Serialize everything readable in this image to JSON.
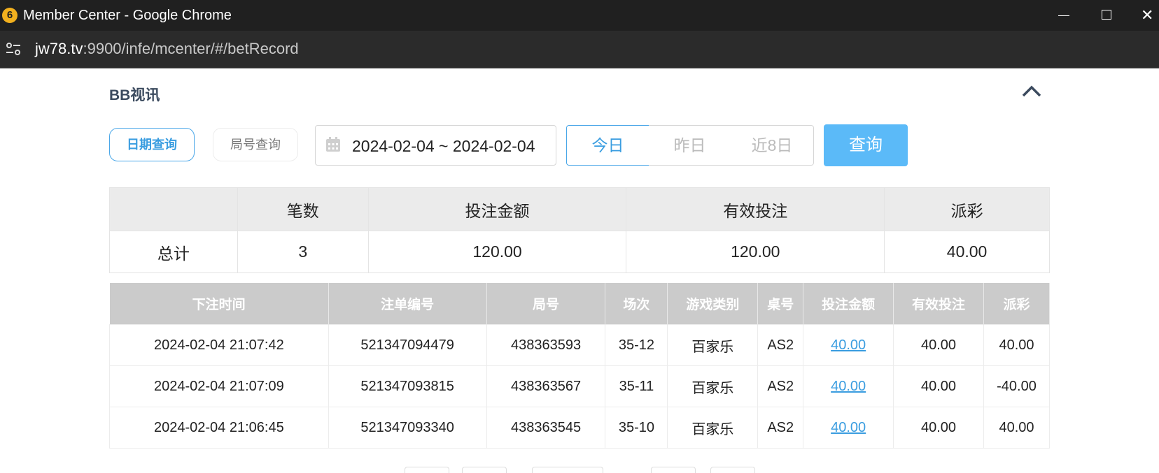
{
  "window": {
    "title": "Member Center - Google Chrome",
    "app_icon_glyph": "6"
  },
  "address_bar": {
    "host": "jw78.tv",
    "rest": ":9900/infe/mcenter/#/betRecord"
  },
  "section": {
    "title": "BB视讯"
  },
  "filters": {
    "date_query_label": "日期查询",
    "round_query_label": "局号查询",
    "date_range": "2024-02-04 ~ 2024-02-04",
    "today_label": "今日",
    "yesterday_label": "昨日",
    "last8_label": "近8日",
    "query_label": "查询"
  },
  "summary": {
    "headers": [
      "",
      "笔数",
      "投注金额",
      "有效投注",
      "派彩"
    ],
    "row": [
      "总计",
      "3",
      "120.00",
      "120.00",
      "40.00"
    ]
  },
  "records": {
    "headers": [
      "下注时间",
      "注单编号",
      "局号",
      "场次",
      "游戏类别",
      "桌号",
      "投注金额",
      "有效投注",
      "派彩"
    ],
    "rows": [
      [
        "2024-02-04 21:07:42",
        "521347094479",
        "438363593",
        "35-12",
        "百家乐",
        "AS2",
        "40.00",
        "40.00",
        "40.00"
      ],
      [
        "2024-02-04 21:07:09",
        "521347093815",
        "438363567",
        "35-11",
        "百家乐",
        "AS2",
        "40.00",
        "40.00",
        "-40.00"
      ],
      [
        "2024-02-04 21:06:45",
        "521347093340",
        "438363545",
        "35-10",
        "百家乐",
        "AS2",
        "40.00",
        "40.00",
        "40.00"
      ]
    ]
  },
  "colors": {
    "accent": "#3a9de0",
    "query_button": "#5bbaf8",
    "negative": "#e5334b"
  }
}
